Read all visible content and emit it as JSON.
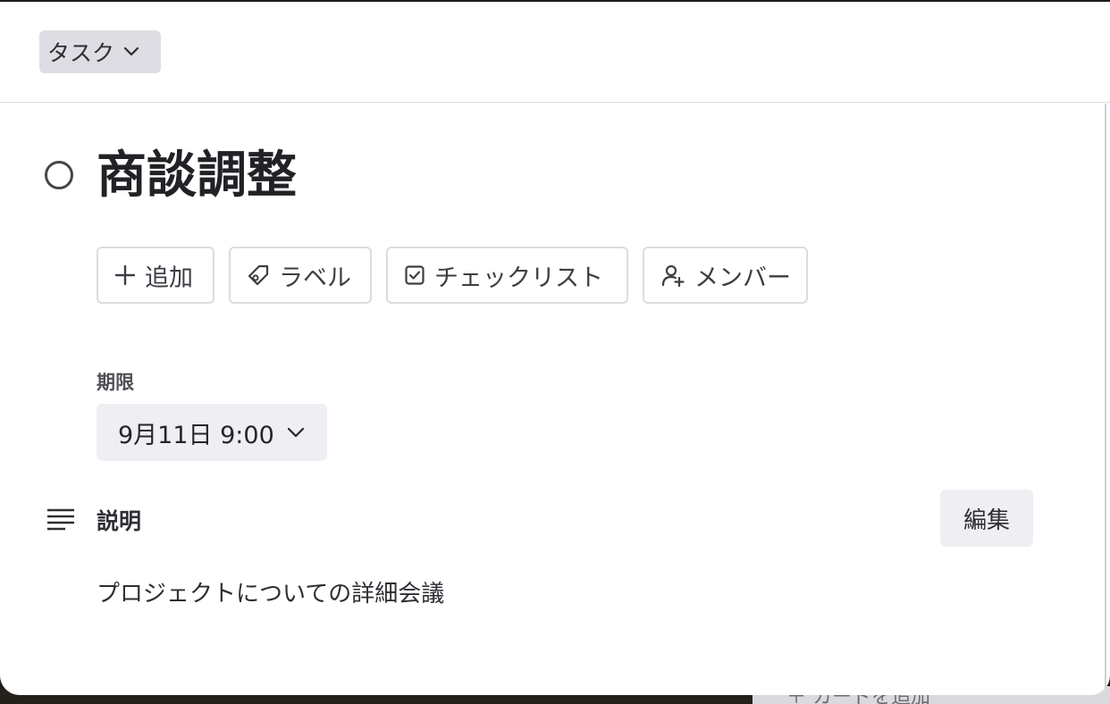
{
  "background": {
    "card_text": "＋ カードを追加"
  },
  "header": {
    "type_selector": "タスク"
  },
  "task": {
    "title": "商談調整"
  },
  "actions": {
    "add": "追加",
    "label": "ラベル",
    "checklist": "チェックリスト",
    "member": "メンバー"
  },
  "due": {
    "label": "期限",
    "value": "9月11日 9:00"
  },
  "description": {
    "label": "説明",
    "edit_label": "編集",
    "text": "プロジェクトについての詳細会議"
  },
  "colors": {
    "text": "#2d2d33",
    "chip_bg": "#efeef2",
    "border": "#dcdce0"
  },
  "icons": [
    "chevron-down-icon",
    "circle-icon",
    "plus-icon",
    "tag-icon",
    "checkbox-icon",
    "add-person-icon",
    "paragraph-icon"
  ]
}
